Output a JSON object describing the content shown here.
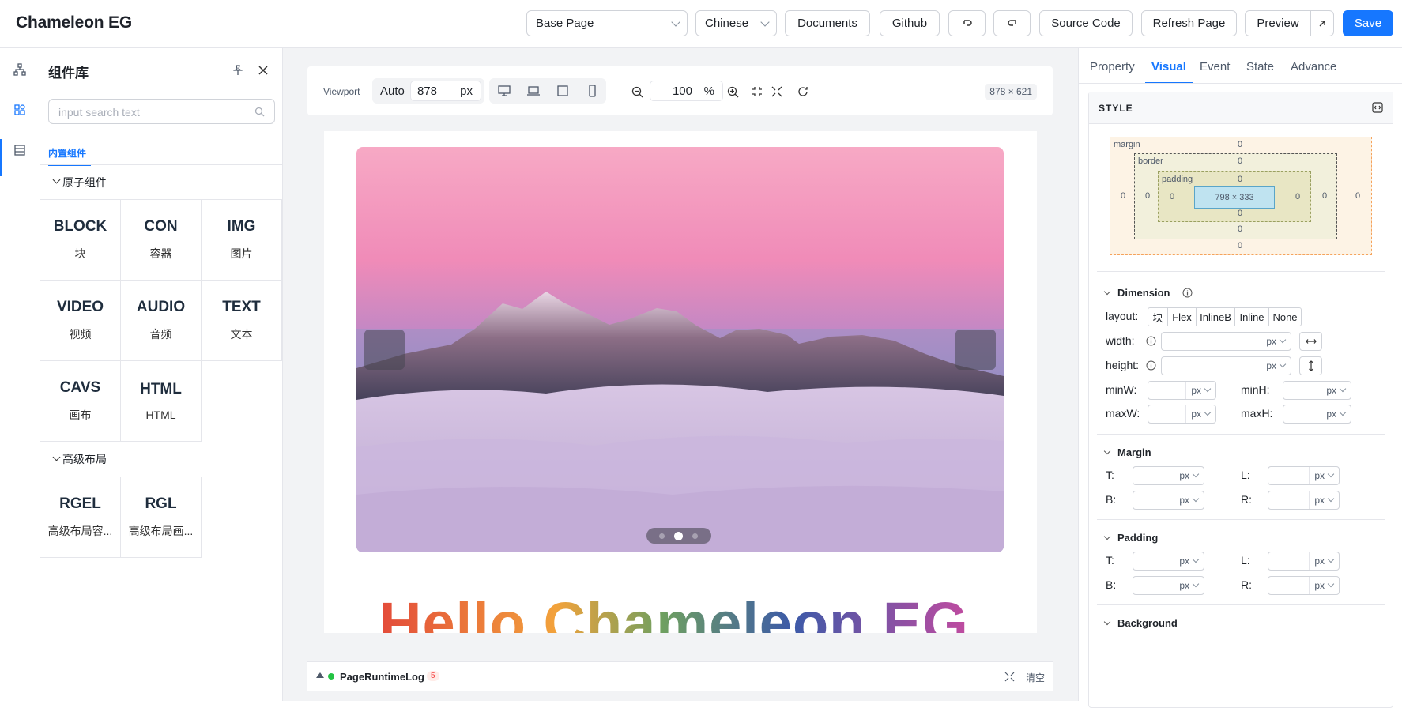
{
  "app": {
    "title": "Chameleon EG"
  },
  "toolbar": {
    "page_select": "Base Page",
    "lang_select": "Chinese",
    "documents": "Documents",
    "github": "Github",
    "source_code": "Source Code",
    "refresh": "Refresh Page",
    "preview": "Preview",
    "save": "Save"
  },
  "left_panel": {
    "title": "组件库",
    "search_placeholder": "input search text",
    "tab": "内置组件",
    "groups": [
      {
        "label": "原子组件",
        "items": [
          {
            "code": "BLOCK",
            "name": "块"
          },
          {
            "code": "CON",
            "name": "容器"
          },
          {
            "code": "IMG",
            "name": "图片"
          },
          {
            "code": "VIDEO",
            "name": "视频"
          },
          {
            "code": "AUDIO",
            "name": "音频"
          },
          {
            "code": "TEXT",
            "name": "文本"
          },
          {
            "code": "CAVS",
            "name": "画布"
          },
          {
            "code": "HTML",
            "name": "HTML"
          }
        ]
      },
      {
        "label": "高级布局",
        "items": [
          {
            "code": "RGEL",
            "name": "高级布局容..."
          },
          {
            "code": "RGL",
            "name": "高级布局画..."
          }
        ]
      }
    ]
  },
  "viewport": {
    "label": "Viewport",
    "mode": "Auto",
    "width": "878",
    "unit": "px",
    "zoom": "100",
    "zoom_unit": "%",
    "size_readout": "878 × 621"
  },
  "canvas": {
    "headline": "Hello Chameleon EG",
    "carousel_active": 2,
    "carousel_count": 3
  },
  "log": {
    "label": "PageRuntimeLog",
    "count": "5",
    "clear": "清空"
  },
  "right_panel": {
    "tabs": [
      "Property",
      "Visual",
      "Event",
      "State",
      "Advance"
    ],
    "active_tab": "Visual",
    "style_title": "STYLE",
    "box_model": {
      "margin_label": "margin",
      "border_label": "border",
      "padding_label": "padding",
      "content_size": "798 × 333",
      "zero": "0"
    },
    "dimension": {
      "title": "Dimension",
      "layout_label": "layout:",
      "layout_options": [
        "块",
        "Flex",
        "InlineB",
        "Inline",
        "None"
      ],
      "width_label": "width:",
      "height_label": "height:",
      "minw": "minW:",
      "minh": "minH:",
      "maxw": "maxW:",
      "maxh": "maxH:",
      "unit": "px"
    },
    "margin": {
      "title": "Margin",
      "t": "T:",
      "l": "L:",
      "b": "B:",
      "r": "R:"
    },
    "padding": {
      "title": "Padding",
      "t": "T:",
      "l": "L:",
      "b": "B:",
      "r": "R:"
    },
    "background": {
      "title": "Background"
    }
  },
  "colors": {
    "accent": "#1677ff"
  }
}
